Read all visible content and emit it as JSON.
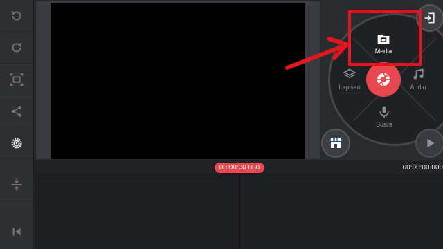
{
  "left_toolbar": {
    "items": [
      {
        "name": "undo",
        "icon": "undo-icon"
      },
      {
        "name": "redo",
        "icon": "redo-icon"
      },
      {
        "name": "crop",
        "icon": "crop-icon"
      },
      {
        "name": "share",
        "icon": "share-icon"
      },
      {
        "name": "settings",
        "icon": "gear-icon"
      },
      {
        "name": "split",
        "icon": "split-icon"
      },
      {
        "name": "skip-to-start",
        "icon": "skip-back-icon"
      }
    ]
  },
  "timeline": {
    "playhead_time": "00:00:00.000",
    "total_time": "00:00:00.000"
  },
  "wheel": {
    "media_label": "Media",
    "layer_label": "Lapisan",
    "audio_label": "Audio",
    "voice_label": "Suara",
    "center_icon": "camera-shutter-icon"
  },
  "colors": {
    "accent": "#e8474f",
    "annotation": "#e3161e",
    "background": "#26272b"
  }
}
